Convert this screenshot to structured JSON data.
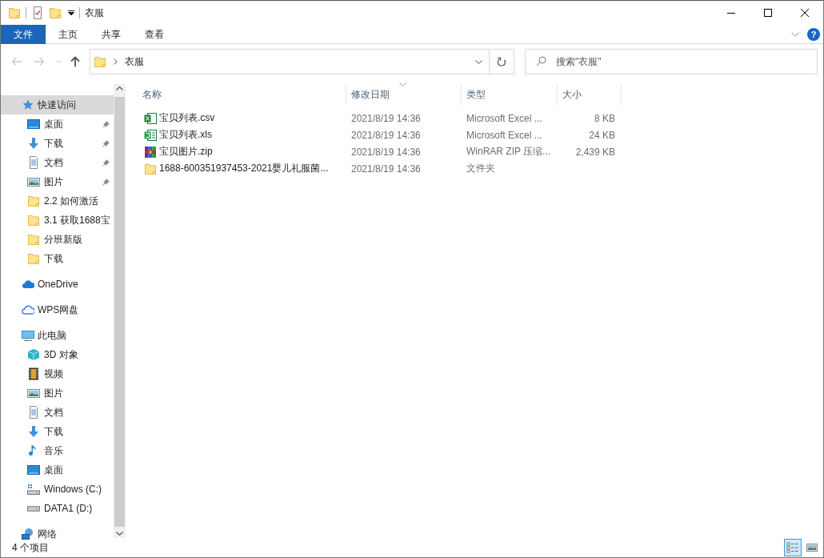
{
  "window": {
    "title": "衣服"
  },
  "ribbon": {
    "tabs": [
      {
        "label": "文件",
        "kind": "menu"
      },
      {
        "label": "主页",
        "kind": "tab"
      },
      {
        "label": "共享",
        "kind": "tab"
      },
      {
        "label": "查看",
        "kind": "tab"
      }
    ],
    "help": "?"
  },
  "address": {
    "path": [
      "衣服"
    ]
  },
  "search": {
    "placeholder": "搜索\"衣服\""
  },
  "navigation": [
    {
      "label": "快速访问",
      "kind": "star",
      "selected": true,
      "children": [
        {
          "label": "桌面",
          "kind": "desktop",
          "pinned": true,
          "selected": false
        },
        {
          "label": "下载",
          "kind": "download",
          "pinned": true,
          "selected": false
        },
        {
          "label": "文档",
          "kind": "document",
          "pinned": true,
          "selected": false
        },
        {
          "label": "图片",
          "kind": "picture",
          "pinned": true,
          "selected": false
        },
        {
          "label": "2.2 如何激活",
          "kind": "folder",
          "pinned": false,
          "selected": false
        },
        {
          "label": "3.1 获取1688宝",
          "kind": "folder",
          "pinned": false,
          "selected": false
        },
        {
          "label": "分班新版",
          "kind": "folder",
          "pinned": false,
          "selected": false
        },
        {
          "label": "下载",
          "kind": "folder",
          "pinned": false,
          "selected": false
        }
      ]
    },
    {
      "label": "OneDrive",
      "kind": "onedrive",
      "selected": false
    },
    {
      "label": "WPS网盘",
      "kind": "cloud",
      "selected": false
    },
    {
      "label": "此电脑",
      "kind": "pc",
      "selected": false,
      "children": [
        {
          "label": "3D 对象",
          "kind": "cube",
          "pinned": false,
          "selected": false
        },
        {
          "label": "视频",
          "kind": "video",
          "pinned": false,
          "selected": false
        },
        {
          "label": "图片",
          "kind": "picture",
          "pinned": false,
          "selected": false
        },
        {
          "label": "文档",
          "kind": "document",
          "pinned": false,
          "selected": false
        },
        {
          "label": "下载",
          "kind": "download",
          "pinned": false,
          "selected": false
        },
        {
          "label": "音乐",
          "kind": "music",
          "pinned": false,
          "selected": false
        },
        {
          "label": "桌面",
          "kind": "desktop",
          "pinned": false,
          "selected": false
        },
        {
          "label": "Windows (C:)",
          "kind": "drive-win",
          "pinned": false,
          "selected": false
        },
        {
          "label": "DATA1 (D:)",
          "kind": "drive",
          "pinned": false,
          "selected": false
        }
      ]
    },
    {
      "label": "网络",
      "kind": "network",
      "selected": false
    }
  ],
  "columns": [
    {
      "label": "名称",
      "sorted": false
    },
    {
      "label": "修改日期",
      "sorted": true
    },
    {
      "label": "类型",
      "sorted": false
    },
    {
      "label": "大小",
      "sorted": false
    }
  ],
  "files": [
    {
      "name": "宝贝列表.csv",
      "kind": "csv",
      "modified": "2021/8/19 14:36",
      "type": "Microsoft Excel ...",
      "size": "8 KB"
    },
    {
      "name": "宝贝列表.xls",
      "kind": "xls",
      "modified": "2021/8/19 14:36",
      "type": "Microsoft Excel ...",
      "size": "24 KB"
    },
    {
      "name": "宝贝图片.zip",
      "kind": "zip",
      "modified": "2021/8/19 14:36",
      "type": "WinRAR ZIP 压缩...",
      "size": "2,439 KB"
    },
    {
      "name": "1688-600351937453-2021婴儿礼服菌...",
      "kind": "folder",
      "modified": "2021/8/19 14:36",
      "type": "文件夹"
    }
  ],
  "status_bar": {
    "count": "4 个项目"
  },
  "views": [
    {
      "kind": "details",
      "selected": true
    },
    {
      "kind": "thumbnails",
      "selected": false
    }
  ]
}
